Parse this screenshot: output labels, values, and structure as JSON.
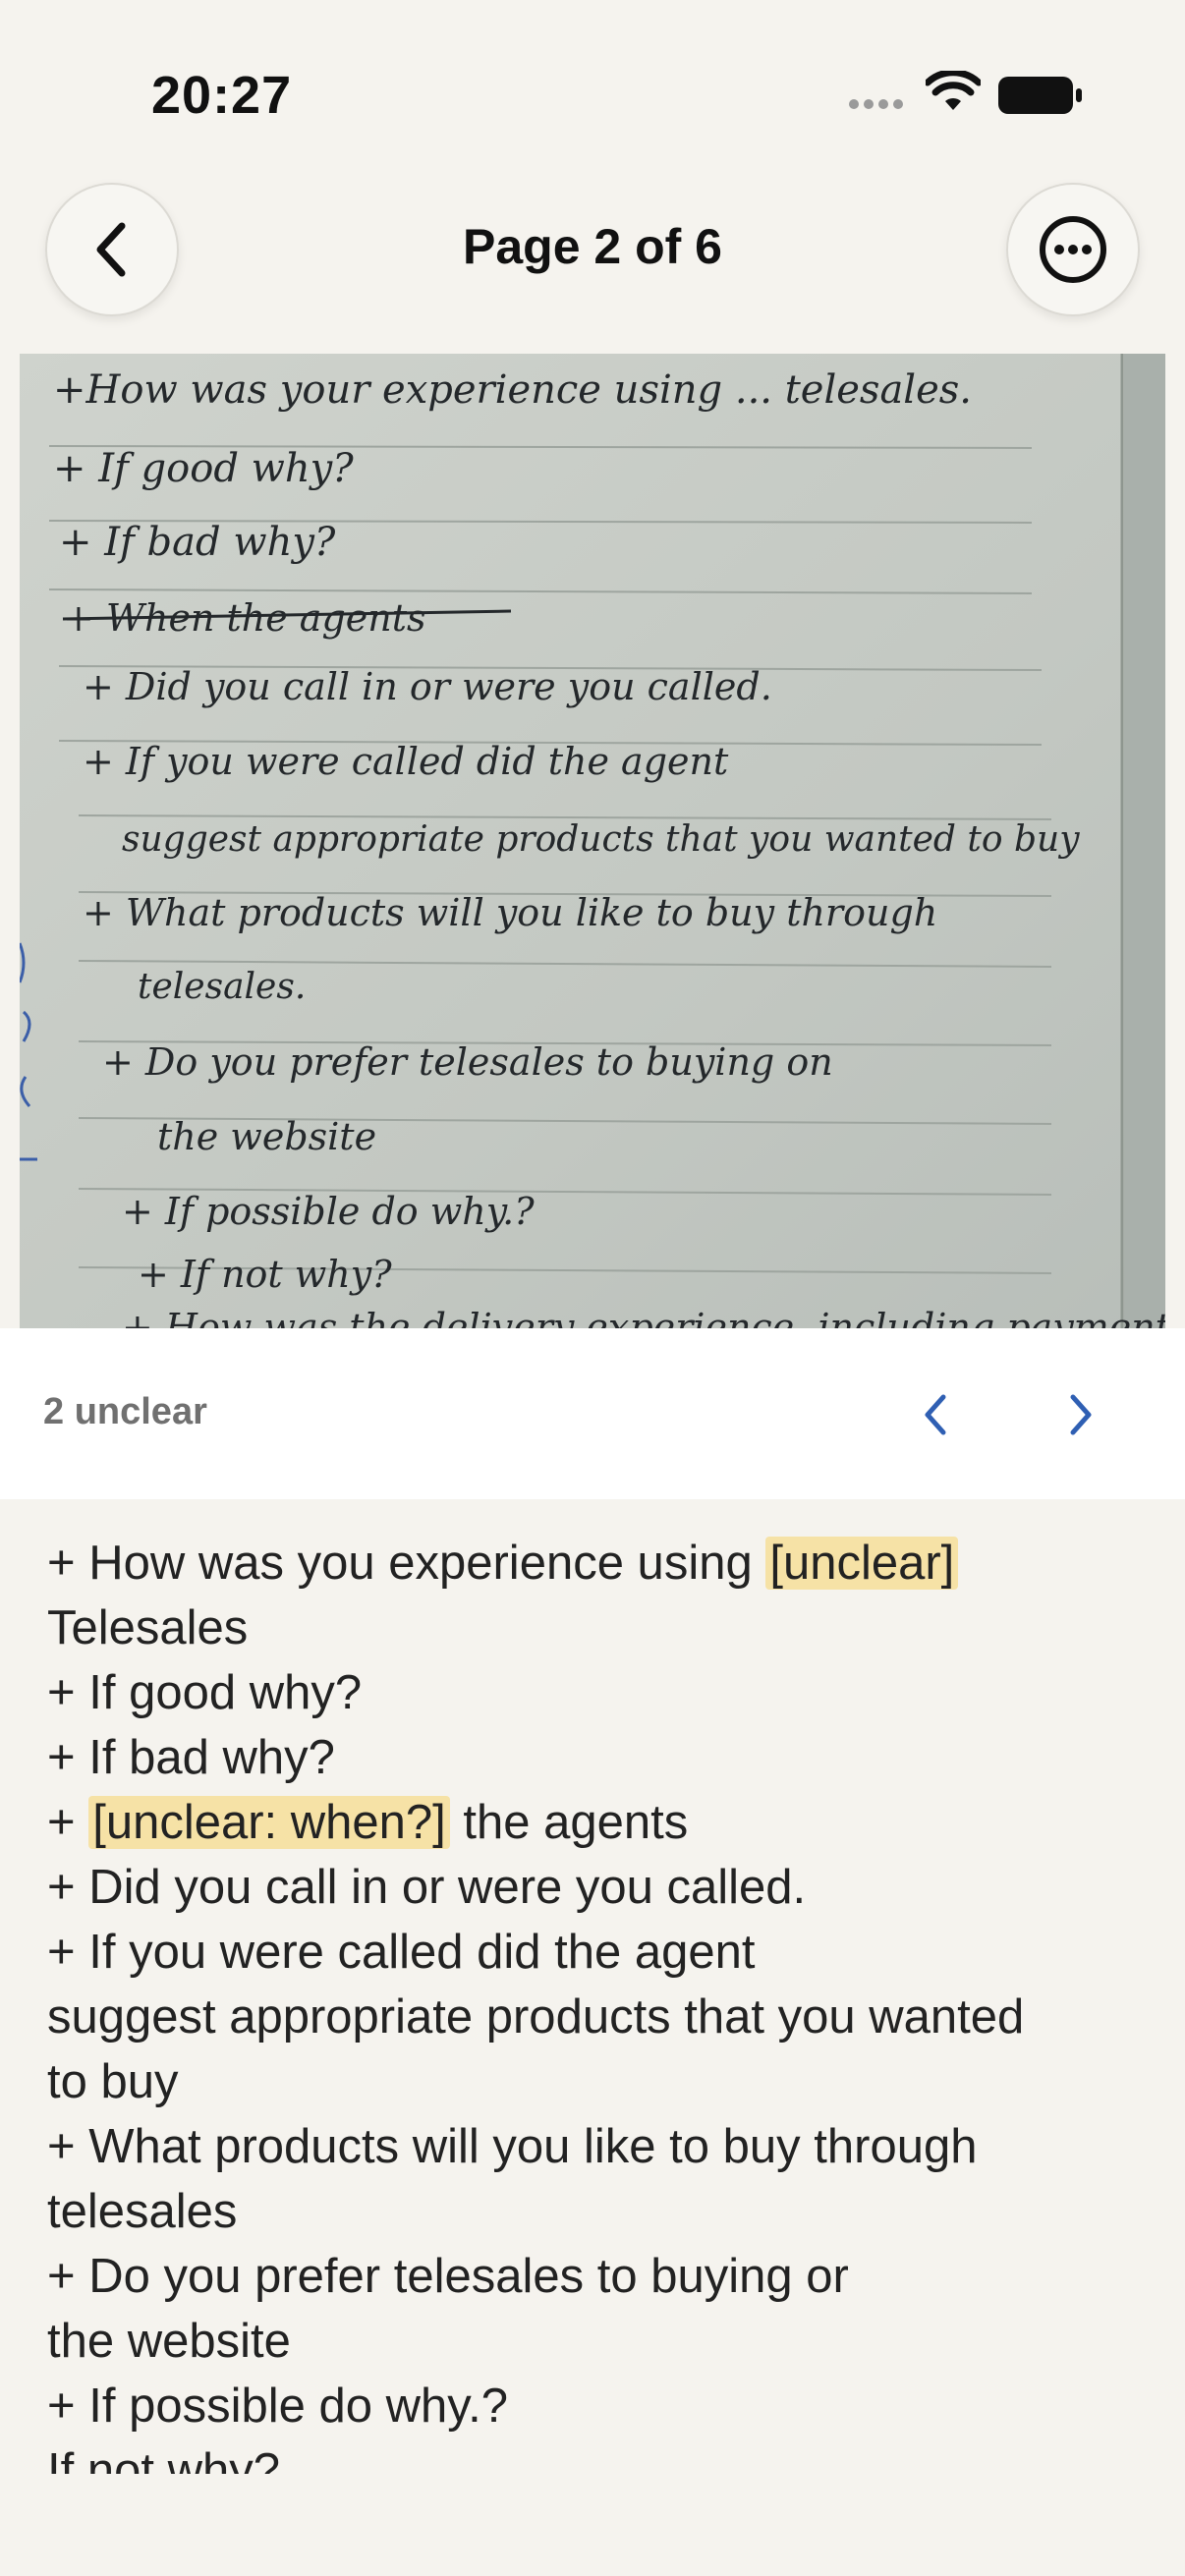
{
  "status_bar": {
    "time": "20:27"
  },
  "header": {
    "title": "Page 2 of 6"
  },
  "unclear_nav": {
    "count_label": "2 unclear"
  },
  "transcript": {
    "lines": [
      {
        "before": "+ How was you experience using ",
        "highlight": "[unclear]",
        "after": ""
      },
      {
        "before": "Telesales",
        "highlight": "",
        "after": ""
      },
      {
        "before": "+ If good why?",
        "highlight": "",
        "after": ""
      },
      {
        "before": "+ If bad why?",
        "highlight": "",
        "after": ""
      },
      {
        "before": "+ ",
        "highlight": "[unclear: when?]",
        "after": " the agents"
      },
      {
        "before": "+ Did you call in or were you called.",
        "highlight": "",
        "after": ""
      },
      {
        "before": "+ If you were called did the agent",
        "highlight": "",
        "after": ""
      },
      {
        "before": "suggest appropriate products that you wanted",
        "highlight": "",
        "after": ""
      },
      {
        "before": "to buy",
        "highlight": "",
        "after": ""
      },
      {
        "before": "+ What products will you like to buy through",
        "highlight": "",
        "after": ""
      },
      {
        "before": "telesales",
        "highlight": "",
        "after": ""
      },
      {
        "before": "+ Do you prefer telesales to buying or",
        "highlight": "",
        "after": ""
      },
      {
        "before": "the website",
        "highlight": "",
        "after": ""
      },
      {
        "before": "+ If possible do why.?",
        "highlight": "",
        "after": ""
      },
      {
        "before": "If not why?",
        "highlight": "",
        "after": ""
      }
    ]
  },
  "handwriting": {
    "lines": [
      "+How was your experience using ... telesales.",
      "+ If good why?",
      "+ If bad why?",
      "+ When the agents",
      "+ Did you call in or were you called.",
      "+ If you were called did the agent",
      "suggest appropriate products that you wanted to buy",
      "+ What products will you like to buy through",
      "telesales.",
      "+ Do you prefer telesales to buying on",
      "the website",
      "+ If possible do why.?",
      "+ If not why?",
      "+ How was the delivery experience. including payment"
    ]
  },
  "colors": {
    "accent": "#2f5fb3",
    "highlight": "#f6e2a6",
    "background": "#f5f3ee"
  }
}
